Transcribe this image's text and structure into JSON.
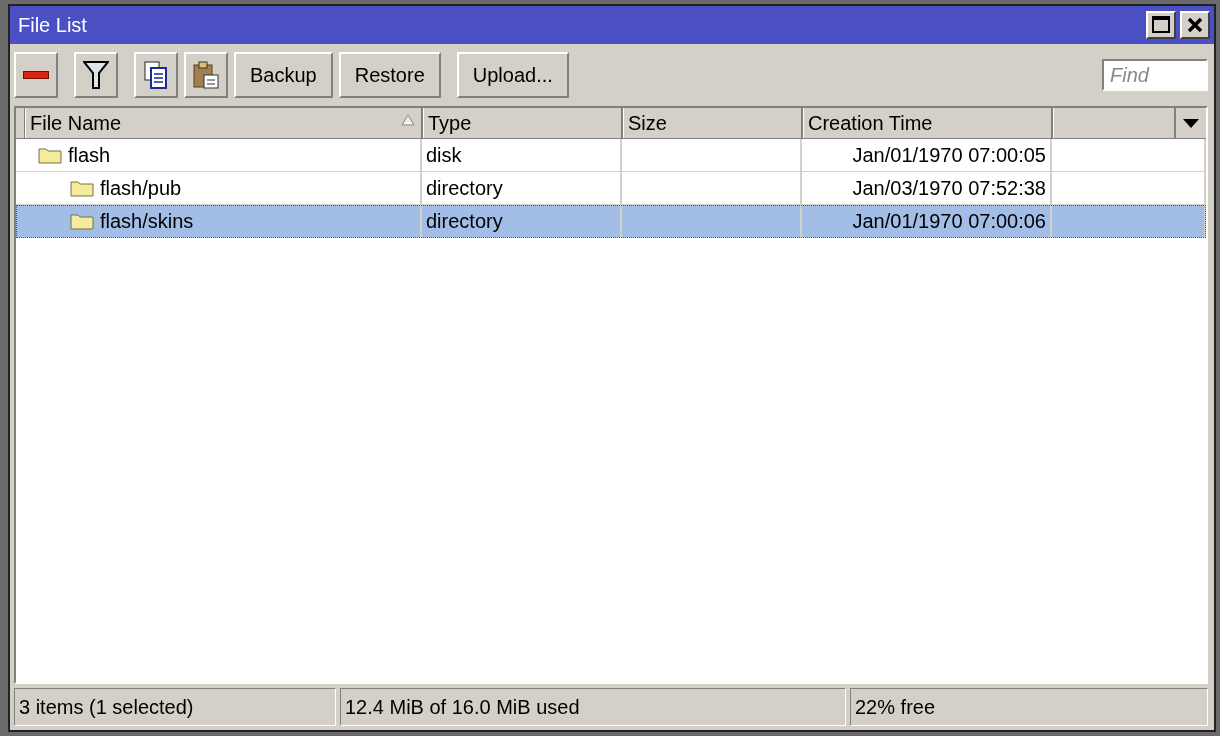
{
  "window": {
    "title": "File List"
  },
  "toolbar": {
    "buttons": [
      "Backup",
      "Restore",
      "Upload..."
    ],
    "search": {
      "placeholder": "Find"
    }
  },
  "table": {
    "columns": [
      {
        "label": "File Name",
        "sorted": true
      },
      {
        "label": "Type",
        "sorted": false
      },
      {
        "label": "Size",
        "sorted": false
      },
      {
        "label": "Creation Time",
        "sorted": false
      }
    ],
    "rows": [
      {
        "name": "flash",
        "type": "disk",
        "created": "Jan/01/1970 07:00:05",
        "selected": false,
        "children": [
          {
            "name": "flash/pub",
            "type": "directory",
            "created": "Jan/03/1970 07:52:38",
            "selected": false
          },
          {
            "name": "flash/skins",
            "type": "directory",
            "created": "Jan/01/1970 07:00:06",
            "selected": true
          }
        ]
      }
    ]
  },
  "status_bar": {
    "items": "3 items (1 selected)",
    "usage": "12.4 MiB of 16.0 MiB used",
    "free": "22% free"
  }
}
